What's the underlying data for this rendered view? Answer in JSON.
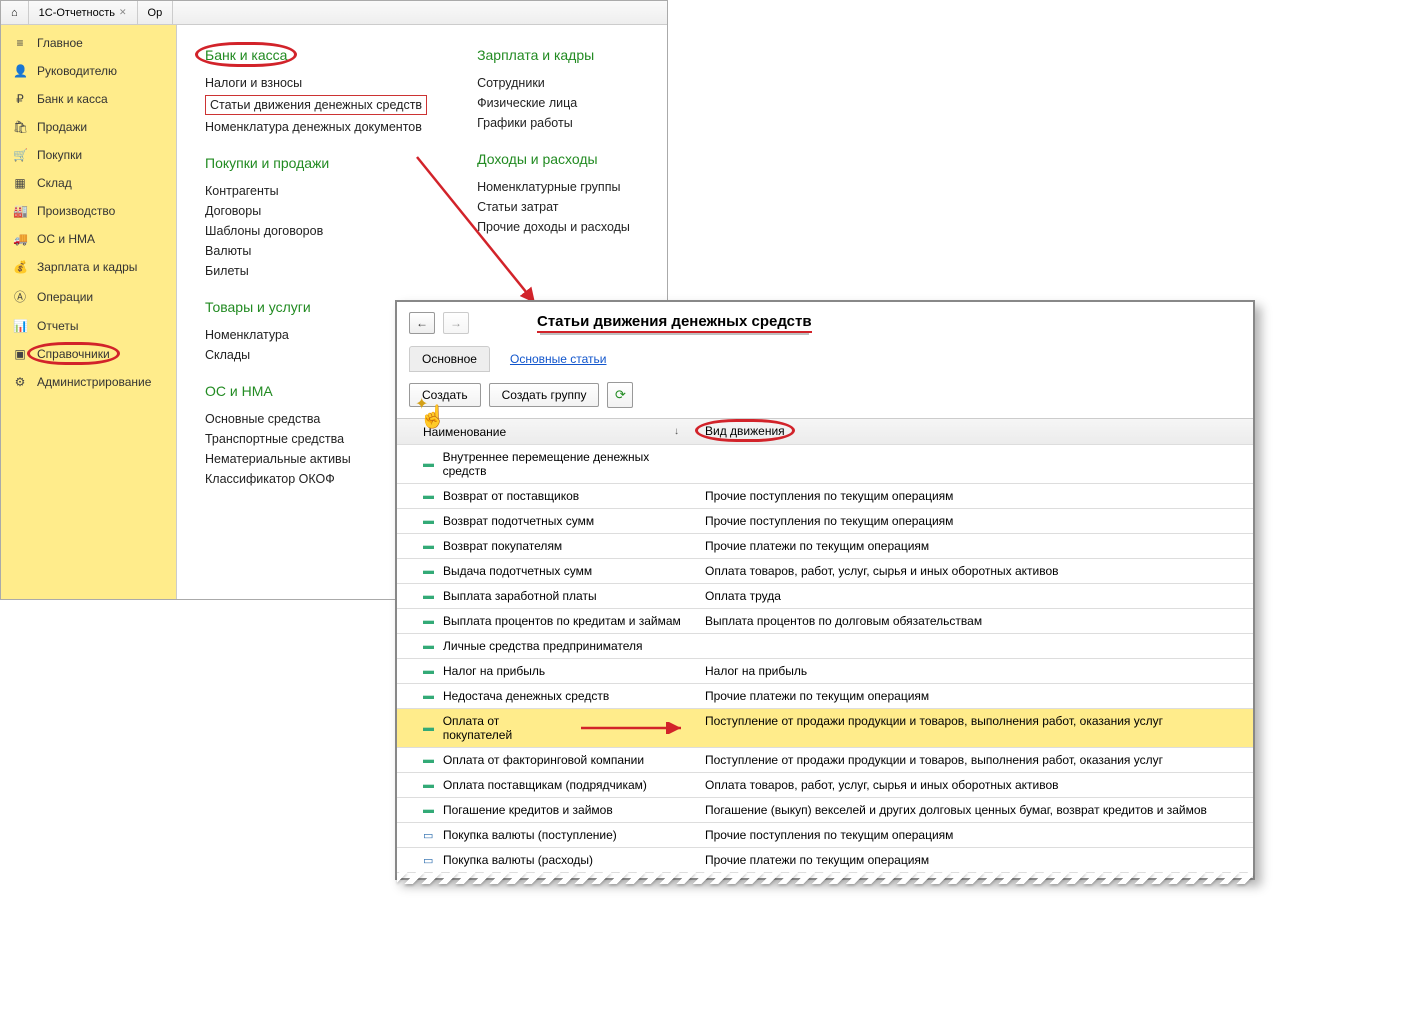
{
  "tabs": [
    {
      "label": ""
    },
    {
      "label": "1С-Отчетность"
    },
    {
      "label": "Ор"
    }
  ],
  "sidebar": [
    {
      "icon": "≡",
      "label": "Главное"
    },
    {
      "icon": "👤",
      "label": "Руководителю"
    },
    {
      "icon": "₽",
      "label": "Банк и касса"
    },
    {
      "icon": "🛍",
      "label": "Продажи"
    },
    {
      "icon": "🛒",
      "label": "Покупки"
    },
    {
      "icon": "▦",
      "label": "Склад"
    },
    {
      "icon": "🏭",
      "label": "Производство"
    },
    {
      "icon": "🚚",
      "label": "ОС и НМА"
    },
    {
      "icon": "💰",
      "label": "Зарплата и кадры"
    },
    {
      "icon": "Ⓐ",
      "label": "Операции"
    },
    {
      "icon": "📊",
      "label": "Отчеты"
    },
    {
      "icon": "▣",
      "label": "Справочники"
    },
    {
      "icon": "⚙",
      "label": "Администрирование"
    }
  ],
  "content": {
    "left_sections": [
      {
        "title": "Банк и касса",
        "highlighted": true,
        "links": [
          {
            "text": "Налоги и взносы"
          },
          {
            "text": "Статьи движения денежных средств",
            "boxed": true
          },
          {
            "text": "Номенклатура денежных документов"
          }
        ]
      },
      {
        "title": "Покупки и продажи",
        "links": [
          {
            "text": "Контрагенты"
          },
          {
            "text": "Договоры"
          },
          {
            "text": "Шаблоны договоров"
          },
          {
            "text": "Валюты"
          },
          {
            "text": "Билеты"
          }
        ]
      },
      {
        "title": "Товары и услуги",
        "links": [
          {
            "text": "Номенклатура"
          },
          {
            "text": "Склады"
          }
        ]
      },
      {
        "title": "ОС и НМА",
        "links": [
          {
            "text": "Основные средства"
          },
          {
            "text": "Транспортные средства"
          },
          {
            "text": "Нематериальные активы"
          },
          {
            "text": "Классификатор ОКОФ"
          }
        ]
      }
    ],
    "right_sections": [
      {
        "title": "Зарплата и кадры",
        "links": [
          {
            "text": "Сотрудники"
          },
          {
            "text": "Физические лица"
          },
          {
            "text": "Графики работы"
          }
        ]
      },
      {
        "title": "Доходы и расходы",
        "links": [
          {
            "text": "Номенклатурные группы"
          },
          {
            "text": "Статьи затрат"
          },
          {
            "text": "Прочие доходы и расходы"
          }
        ]
      }
    ]
  },
  "popup": {
    "title": "Статьи движения денежных средств",
    "tabs": {
      "main": "Основное",
      "link": "Основные статьи"
    },
    "buttons": {
      "create": "Создать",
      "group": "Создать группу"
    },
    "columns": {
      "name": "Наименование",
      "kind": "Вид движения"
    },
    "rows": [
      {
        "name": "Внутреннее перемещение денежных средств",
        "kind": ""
      },
      {
        "name": "Возврат от поставщиков",
        "kind": "Прочие поступления по текущим операциям"
      },
      {
        "name": "Возврат подотчетных сумм",
        "kind": "Прочие поступления по текущим операциям"
      },
      {
        "name": "Возврат покупателям",
        "kind": "Прочие платежи по текущим операциям"
      },
      {
        "name": "Выдача подотчетных сумм",
        "kind": "Оплата товаров, работ, услуг, сырья и иных оборотных активов"
      },
      {
        "name": "Выплата заработной платы",
        "kind": "Оплата труда"
      },
      {
        "name": "Выплата процентов по кредитам и займам",
        "kind": "Выплата процентов по долговым обязательствам"
      },
      {
        "name": "Личные средства предпринимателя",
        "kind": ""
      },
      {
        "name": "Налог на прибыль",
        "kind": "Налог на прибыль"
      },
      {
        "name": "Недостача денежных средств",
        "kind": "Прочие платежи по текущим операциям"
      },
      {
        "name": "Оплата от покупателей",
        "kind": "Поступление от продажи продукции и товаров, выполнения работ, оказания услуг",
        "highlight": true,
        "arrow": true
      },
      {
        "name": "Оплата от факторинговой компании",
        "kind": "Поступление от продажи продукции и товаров, выполнения работ, оказания услуг"
      },
      {
        "name": "Оплата поставщикам (подрядчикам)",
        "kind": "Оплата товаров, работ, услуг, сырья и иных оборотных активов"
      },
      {
        "name": "Погашение кредитов и займов",
        "kind": "Погашение (выкуп) векселей и других долговых ценных бумаг, возврат кредитов и займов"
      },
      {
        "name": "Покупка валюты (поступление)",
        "kind": "Прочие поступления по текущим операциям",
        "blue": true
      },
      {
        "name": "Покупка валюты (расходы)",
        "kind": "Прочие платежи по текущим операциям",
        "blue": true
      }
    ]
  }
}
